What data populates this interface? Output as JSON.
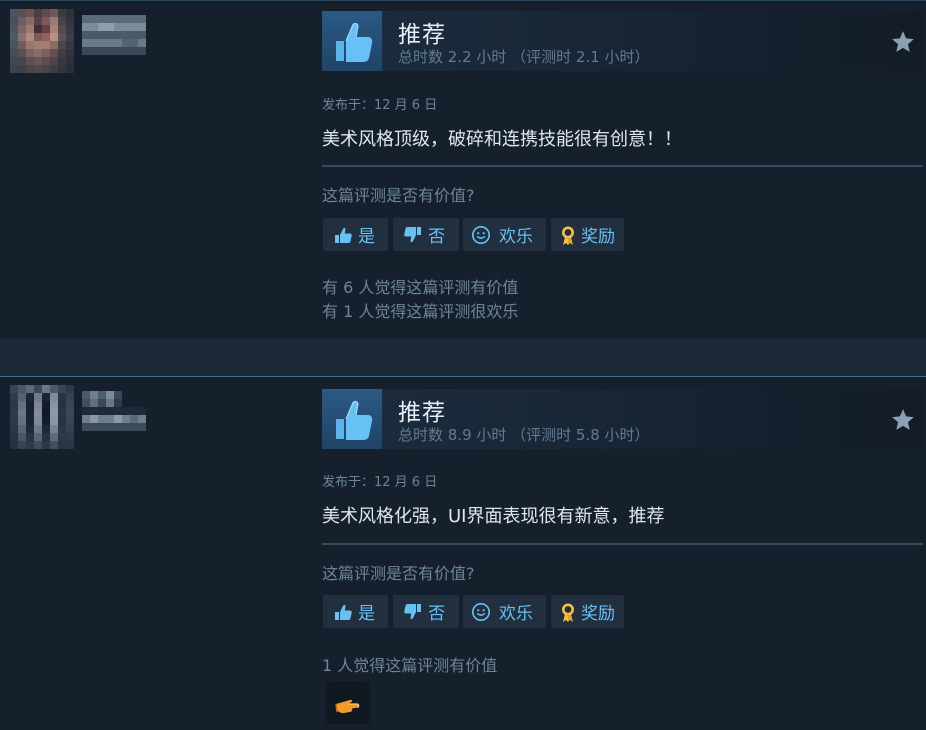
{
  "reviews": [
    {
      "verdict": "推荐",
      "hours": "总时数 2.2 小时 （评测时 2.1 小时）",
      "posted": "发布于：12 月 6 日",
      "content": "美术风格顶级，破碎和连携技能很有创意！！",
      "helpful_question": "这篇评测是否有价值?",
      "buttons": {
        "yes": "是",
        "no": "否",
        "funny": "欢乐",
        "award": "奖励"
      },
      "stats": [
        "有 6 人觉得这篇评测有价值",
        "有 1 人觉得这篇评测很欢乐"
      ]
    },
    {
      "verdict": "推荐",
      "hours": "总时数 8.9 小时 （评测时 5.8 小时）",
      "posted": "发布于：12 月 6 日",
      "content": "美术风格化强，UI界面表现很有新意，推荐",
      "helpful_question": "这篇评测是否有价值?",
      "buttons": {
        "yes": "是",
        "no": "否",
        "funny": "欢乐",
        "award": "奖励"
      },
      "stats": [
        "1 人觉得这篇评测有价值"
      ],
      "award_icon": "pointing-hand-award-icon"
    }
  ],
  "colors": {
    "background": "#1b2838",
    "review_bg": "#16202d",
    "link_blue": "#67c1f5",
    "muted_text": "#6c8599",
    "award_gold": "#f5c043",
    "award_orange": "#f39a2a"
  }
}
